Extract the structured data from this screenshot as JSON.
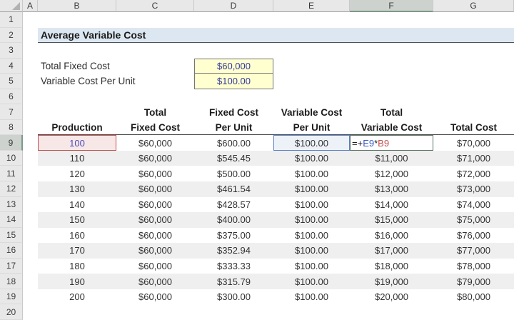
{
  "title": "Average Variable Cost",
  "column_headers": [
    "A",
    "B",
    "C",
    "D",
    "E",
    "F",
    "G"
  ],
  "row_numbers": [
    "1",
    "2",
    "3",
    "4",
    "5",
    "6",
    "7",
    "8",
    "9",
    "10",
    "11",
    "12",
    "13",
    "14",
    "15",
    "16",
    "17",
    "18",
    "19",
    "20"
  ],
  "selection": {
    "active_cell": "F9",
    "selected_column": "F",
    "selected_row": "9"
  },
  "params": [
    {
      "label": "Total Fixed Cost",
      "value": "$60,000"
    },
    {
      "label": "Variable Cost Per Unit",
      "value": "$100.00"
    }
  ],
  "table": {
    "headers_line1": {
      "total": "Total",
      "fixed_cost": "Fixed Cost",
      "variable_cost": "Variable Cost",
      "total2": "Total"
    },
    "headers_line2": {
      "production": "Production",
      "fixed_cost": "Fixed Cost",
      "per_unit": "Per Unit",
      "per_unit2": "Per Unit",
      "variable_cost": "Variable Cost",
      "total_cost": "Total Cost"
    },
    "rows": [
      {
        "production": "100",
        "total_fixed_cost": "$60,000",
        "fixed_cost_per_unit": "$600.00",
        "variable_cost_per_unit": "$100.00",
        "total_variable_cost": "",
        "total_cost": "$70,000"
      },
      {
        "production": "110",
        "total_fixed_cost": "$60,000",
        "fixed_cost_per_unit": "$545.45",
        "variable_cost_per_unit": "$100.00",
        "total_variable_cost": "$11,000",
        "total_cost": "$71,000"
      },
      {
        "production": "120",
        "total_fixed_cost": "$60,000",
        "fixed_cost_per_unit": "$500.00",
        "variable_cost_per_unit": "$100.00",
        "total_variable_cost": "$12,000",
        "total_cost": "$72,000"
      },
      {
        "production": "130",
        "total_fixed_cost": "$60,000",
        "fixed_cost_per_unit": "$461.54",
        "variable_cost_per_unit": "$100.00",
        "total_variable_cost": "$13,000",
        "total_cost": "$73,000"
      },
      {
        "production": "140",
        "total_fixed_cost": "$60,000",
        "fixed_cost_per_unit": "$428.57",
        "variable_cost_per_unit": "$100.00",
        "total_variable_cost": "$14,000",
        "total_cost": "$74,000"
      },
      {
        "production": "150",
        "total_fixed_cost": "$60,000",
        "fixed_cost_per_unit": "$400.00",
        "variable_cost_per_unit": "$100.00",
        "total_variable_cost": "$15,000",
        "total_cost": "$75,000"
      },
      {
        "production": "160",
        "total_fixed_cost": "$60,000",
        "fixed_cost_per_unit": "$375.00",
        "variable_cost_per_unit": "$100.00",
        "total_variable_cost": "$16,000",
        "total_cost": "$76,000"
      },
      {
        "production": "170",
        "total_fixed_cost": "$60,000",
        "fixed_cost_per_unit": "$352.94",
        "variable_cost_per_unit": "$100.00",
        "total_variable_cost": "$17,000",
        "total_cost": "$77,000"
      },
      {
        "production": "180",
        "total_fixed_cost": "$60,000",
        "fixed_cost_per_unit": "$333.33",
        "variable_cost_per_unit": "$100.00",
        "total_variable_cost": "$18,000",
        "total_cost": "$78,000"
      },
      {
        "production": "190",
        "total_fixed_cost": "$60,000",
        "fixed_cost_per_unit": "$315.79",
        "variable_cost_per_unit": "$100.00",
        "total_variable_cost": "$19,000",
        "total_cost": "$79,000"
      },
      {
        "production": "200",
        "total_fixed_cost": "$60,000",
        "fixed_cost_per_unit": "$300.00",
        "variable_cost_per_unit": "$100.00",
        "total_variable_cost": "$20,000",
        "total_cost": "$80,000"
      }
    ]
  },
  "formula_cell": {
    "cell": "F9",
    "prefix": "=+",
    "ref1": "E9",
    "operator": "*",
    "ref2": "B9"
  },
  "colors": {
    "reference1_blue": "#3b5bc4",
    "reference2_red": "#c0504d",
    "input_fill_yellow": "#ffffcf",
    "input_text_navy": "#333a9e",
    "band_fill": "#efefef",
    "title_fill": "#dde7f1",
    "selected_header_fill": "#cdd2ce",
    "selected_header_accent": "#7b9a89"
  }
}
